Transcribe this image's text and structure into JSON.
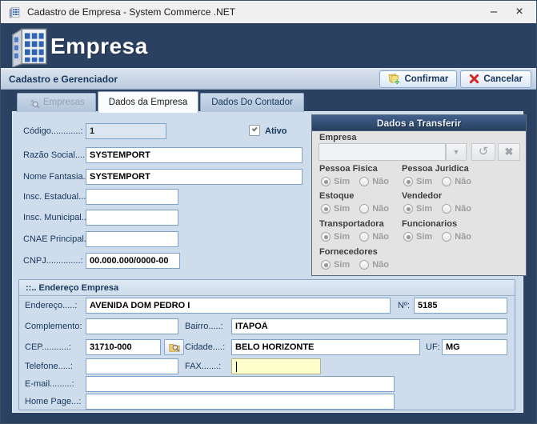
{
  "window": {
    "title": "Cadastro de Empresa -  System Commerce .NET",
    "minimize_glyph": "–",
    "close_glyph": "×"
  },
  "banner": {
    "title": "Empresa"
  },
  "subheader": {
    "title": "Cadastro e Gerenciador",
    "confirm_label": "Confirmar",
    "cancel_label": "Cancelar"
  },
  "tabs": [
    {
      "label": "Empresas",
      "state": "disabled"
    },
    {
      "label": "Dados da Empresa",
      "state": "active"
    },
    {
      "label": "Dados Do Contador",
      "state": "normal"
    }
  ],
  "company_form": {
    "codigo": {
      "label": "Código............:",
      "value": "1"
    },
    "ativo_label": "Ativo",
    "ativo_checked": true,
    "razao_social": {
      "label": "Razão Social.....:",
      "value": "SYSTEMPORT"
    },
    "nome_fantasia": {
      "label": "Nome Fantasia..:",
      "value": "SYSTEMPORT"
    },
    "insc_estadual": {
      "label": "Insc. Estadual...:",
      "value": ""
    },
    "insc_municipal": {
      "label": "Insc. Municipal..:",
      "value": ""
    },
    "cnae": {
      "label": "CNAE Principal.:",
      "value": ""
    },
    "cnpj": {
      "label": "CNPJ..............:",
      "value": "00.000.000/0000-00"
    }
  },
  "transfer": {
    "title": "Dados a Transferir",
    "empresa_label": "Empresa",
    "combo_value": "",
    "dropdown_glyph": "▼",
    "refresh_glyph": "↺",
    "clear_glyph": "✖",
    "sim": "Sim",
    "nao": "Não",
    "groups": [
      "Pessoa Fisica",
      "Pessoa Juridica",
      "Estoque",
      "Vendedor",
      "Transportadora",
      "Funcionarios",
      "Fornecedores"
    ]
  },
  "address": {
    "title": "::.. Endereço Empresa",
    "endereco": {
      "label": "Endereço.....:",
      "value": "AVENIDA DOM PEDRO I"
    },
    "numero": {
      "label": "Nº:",
      "value": "5185"
    },
    "complemento": {
      "label": "Complemento:",
      "value": ""
    },
    "bairro": {
      "label": "Bairro.....:",
      "value": "ITAPOÃ"
    },
    "cep": {
      "label": "CEP...........:",
      "value": "31710-000"
    },
    "cidade": {
      "label": "Cidade....:",
      "value": "BELO HORIZONTE"
    },
    "uf": {
      "label": "UF:",
      "value": "MG"
    },
    "telefone": {
      "label": "Telefone.....:",
      "value": ""
    },
    "fax": {
      "label": "FAX.......:",
      "value": ""
    },
    "email": {
      "label": "E-mail.........:",
      "value": ""
    },
    "homepage": {
      "label": "Home Page...:",
      "value": ""
    }
  },
  "colors": {
    "banner_navy": "#2b4161",
    "content_blue": "#cedcec",
    "focus_yellow": "#ffffcc",
    "cancel_red": "#d42a2a",
    "confirm_yellow": "#f2df7d"
  }
}
